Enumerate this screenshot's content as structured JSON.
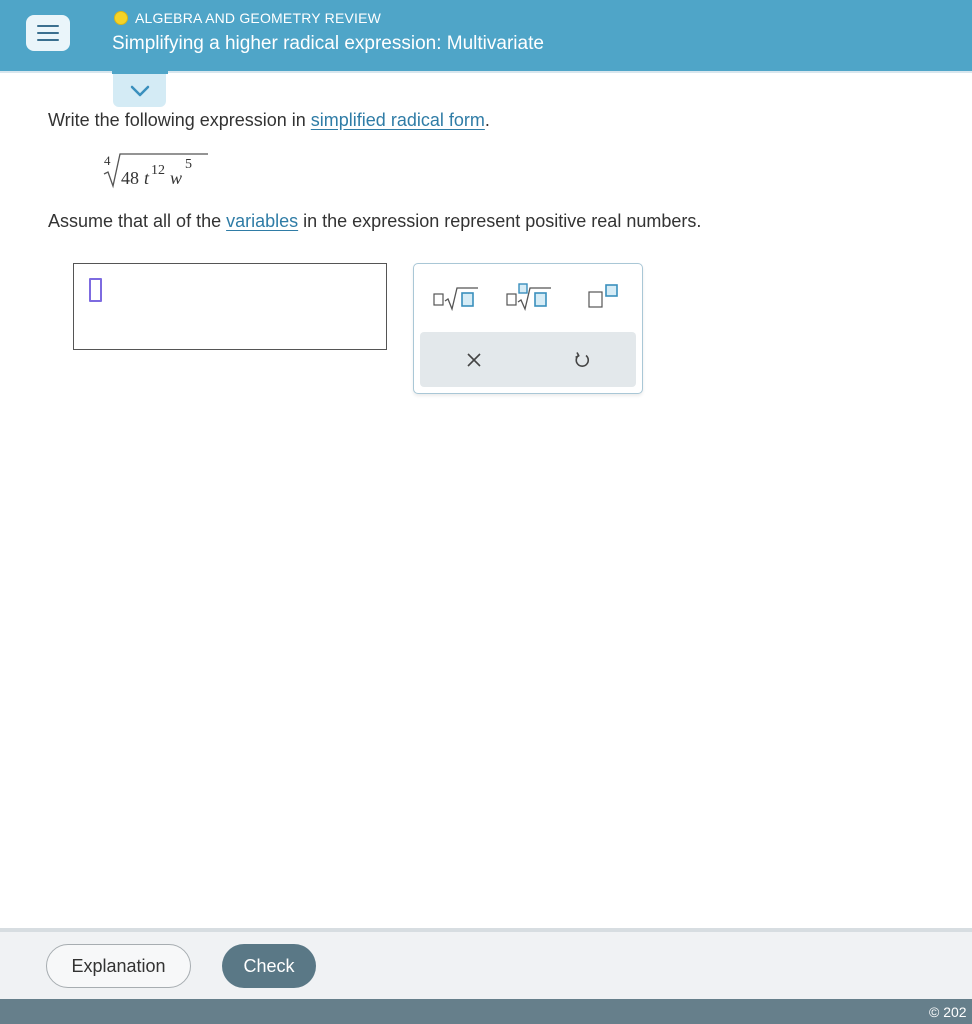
{
  "header": {
    "topic": "ALGEBRA AND GEOMETRY REVIEW",
    "title": "Simplifying a higher radical expression: Multivariate"
  },
  "question": {
    "instruction_prefix": "Write the following expression in ",
    "instruction_link": "simplified radical form",
    "instruction_suffix": ".",
    "expression": {
      "index": "4",
      "coefficient": "48",
      "var1": "t",
      "exp1": "12",
      "var2": "w",
      "exp2": "5"
    },
    "assume_prefix": "Assume that all of the ",
    "assume_link": "variables",
    "assume_suffix": " in the expression represent positive real numbers."
  },
  "palette": {
    "buttons": [
      "square-root-template",
      "nth-root-template",
      "exponent-template"
    ],
    "actions": [
      "clear",
      "undo"
    ]
  },
  "footer": {
    "explanation_label": "Explanation",
    "check_label": "Check",
    "copyright": "© 202"
  },
  "colors": {
    "header": "#4fa5c8",
    "link": "#2f7ca6",
    "check_button": "#5a7886",
    "caret": "#7d6be0"
  }
}
